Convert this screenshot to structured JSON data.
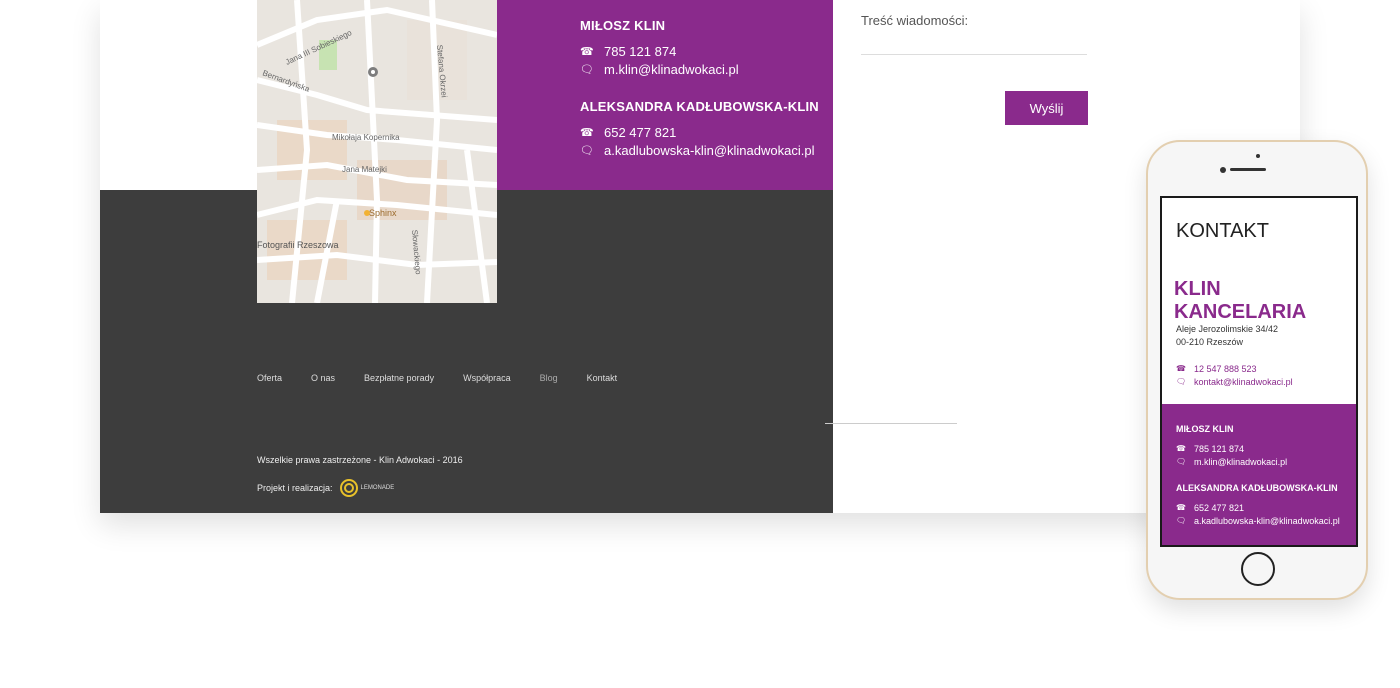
{
  "desktop": {
    "map": {
      "streets": [
        "Jana III Sobieskiego",
        "Bernardyńska",
        "Stefana Okrzei",
        "Mikołaja Kopernika",
        "Jana Matejki",
        "Słowackiego"
      ],
      "places": [
        "Sphinx",
        "Fotografii Rzeszowa"
      ]
    },
    "persons": [
      {
        "name": "MIŁOSZ KLIN",
        "phone": "785 121 874",
        "email": "m.klin@klinadwokaci.pl"
      },
      {
        "name": "ALEKSANDRA KADŁUBOWSKA-KLIN",
        "phone": "652 477 821",
        "email": "a.kadlubowska-klin@klinadwokaci.pl"
      }
    ],
    "form": {
      "message_label": "Treść wiadomości:",
      "send_label": "Wyślij"
    },
    "footer": {
      "nav": [
        "Oferta",
        "O nas",
        "Bezpłatne porady",
        "Współpraca",
        "Blog",
        "Kontakt"
      ],
      "copyright": "Wszelkie prawa zastrzeżone - Klin Adwokaci - 2016",
      "credit": "Projekt i realizacja:",
      "credit_logo": "LEMONADE"
    }
  },
  "mobile": {
    "title": "KONTAKT",
    "brand": "KLIN KANCELARIA",
    "address1": "Aleje Jerozolimskie 34/42",
    "address2": "00-210 Rzeszów",
    "phone": "12 547 888 523",
    "email": "kontakt@klinadwokaci.pl",
    "persons": [
      {
        "name": "MIŁOSZ KLIN",
        "phone": "785 121 874",
        "email": "m.klin@klinadwokaci.pl"
      },
      {
        "name": "ALEKSANDRA KADŁUBOWSKA-KLIN",
        "phone": "652 477 821",
        "email": "a.kadlubowska-klin@klinadwokaci.pl"
      }
    ]
  },
  "icons": {
    "phone": "phone-icon",
    "email": "chat-bubble-icon"
  },
  "colors": {
    "accent": "#8a2a8c",
    "footer": "#3d3d3d"
  }
}
